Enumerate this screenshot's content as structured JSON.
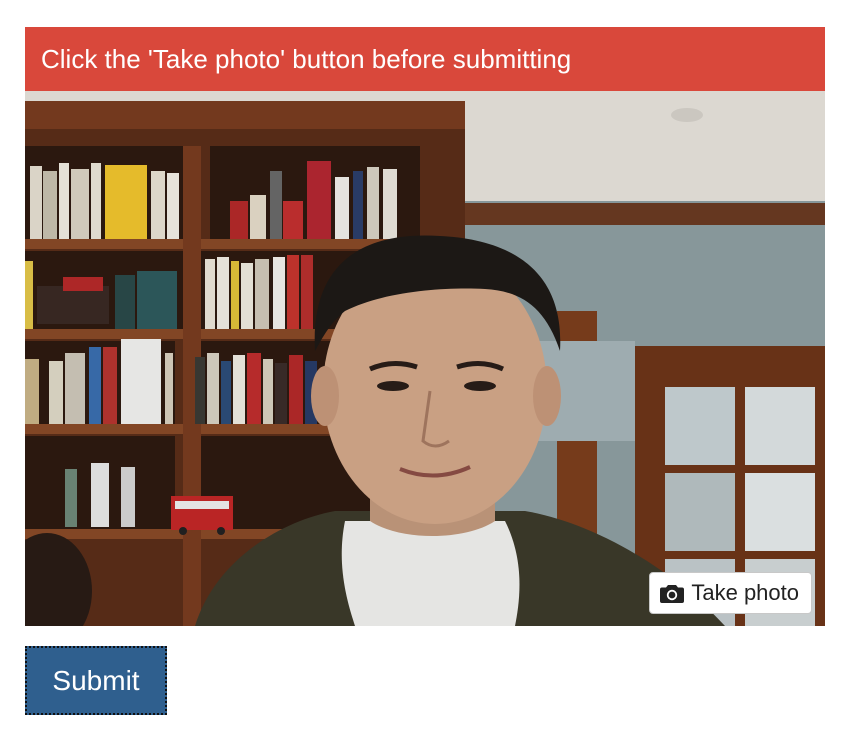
{
  "alert": {
    "message": "Click the 'Take photo' button before submitting",
    "color": "#d9483b"
  },
  "camera": {
    "take_photo_label": "Take photo",
    "take_photo_icon": "camera-icon"
  },
  "form": {
    "submit_label": "Submit",
    "submit_color": "#2f5f8e"
  }
}
